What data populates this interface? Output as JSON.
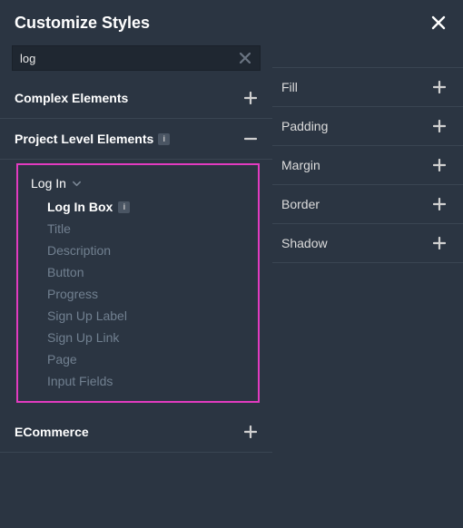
{
  "header": {
    "title": "Customize Styles"
  },
  "search": {
    "value": "log"
  },
  "left": {
    "sections": {
      "complex": {
        "label": "Complex Elements",
        "expanded": false
      },
      "project": {
        "label": "Project Level Elements",
        "expanded": true
      },
      "ecommerce": {
        "label": "ECommerce",
        "expanded": false
      }
    },
    "tree": {
      "parent": "Log In",
      "items": [
        {
          "label": "Log In Box",
          "active": true,
          "info": true
        },
        {
          "label": "Title",
          "active": false
        },
        {
          "label": "Description",
          "active": false
        },
        {
          "label": "Button",
          "active": false
        },
        {
          "label": "Progress",
          "active": false
        },
        {
          "label": "Sign Up Label",
          "active": false
        },
        {
          "label": "Sign Up Link",
          "active": false
        },
        {
          "label": "Page",
          "active": false
        },
        {
          "label": "Input Fields",
          "active": false
        }
      ]
    }
  },
  "right": {
    "props": [
      {
        "label": "Fill"
      },
      {
        "label": "Padding"
      },
      {
        "label": "Margin"
      },
      {
        "label": "Border"
      },
      {
        "label": "Shadow"
      }
    ]
  }
}
